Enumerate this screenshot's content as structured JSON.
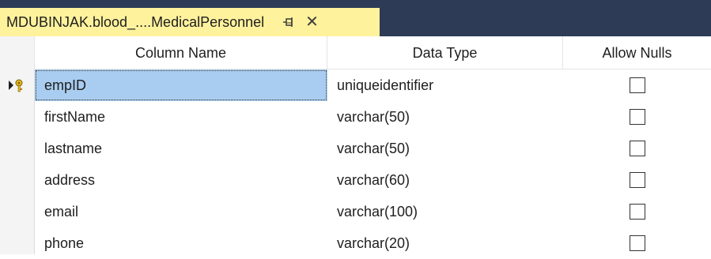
{
  "tab": {
    "title": "MDUBINJAK.blood_....MedicalPersonnel",
    "pin_icon": "pin-icon",
    "close_icon": "close-icon",
    "close_glyph": "✕",
    "active_color": "#fff29d",
    "bar_color": "#2d3b56"
  },
  "grid": {
    "headers": {
      "column_name": "Column Name",
      "data_type": "Data Type",
      "allow_nulls": "Allow Nulls"
    },
    "selected_color": "#a9cdf0",
    "rows": [
      {
        "column_name": "empID",
        "data_type": "uniqueidentifier",
        "allow_nulls": false,
        "primary_key": true,
        "current": true
      },
      {
        "column_name": "firstName",
        "data_type": "varchar(50)",
        "allow_nulls": false
      },
      {
        "column_name": "lastname",
        "data_type": "varchar(50)",
        "allow_nulls": false
      },
      {
        "column_name": "address",
        "data_type": "varchar(60)",
        "allow_nulls": false
      },
      {
        "column_name": "email",
        "data_type": "varchar(100)",
        "allow_nulls": false
      },
      {
        "column_name": "phone",
        "data_type": "varchar(20)",
        "allow_nulls": false
      }
    ]
  }
}
